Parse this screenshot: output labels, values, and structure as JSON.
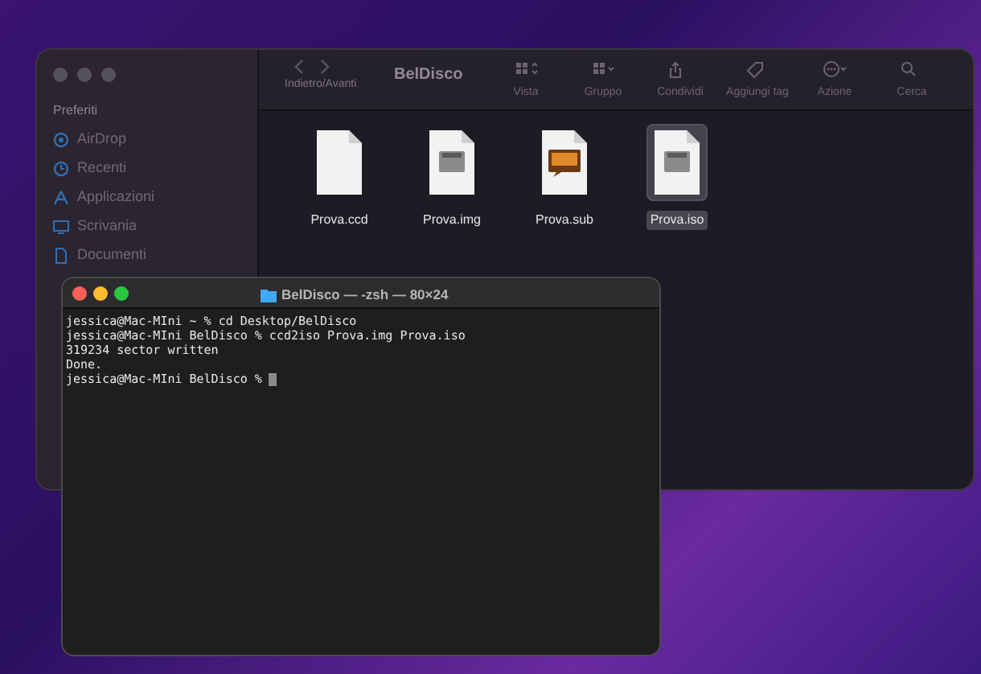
{
  "finder": {
    "title": "BelDisco",
    "nav_label": "Indietro/Avanti",
    "sidebar": {
      "section": "Preferiti",
      "items": [
        {
          "label": "AirDrop",
          "kind": "airdrop"
        },
        {
          "label": "Recenti",
          "kind": "clock"
        },
        {
          "label": "Applicazioni",
          "kind": "apps"
        },
        {
          "label": "Scrivania",
          "kind": "desktop"
        },
        {
          "label": "Documenti",
          "kind": "doc"
        }
      ]
    },
    "toolbar": [
      {
        "label": "Vista",
        "kind": "grid"
      },
      {
        "label": "Gruppo",
        "kind": "group"
      },
      {
        "label": "Condividi",
        "kind": "share"
      },
      {
        "label": "Aggiungi tag",
        "kind": "tag"
      },
      {
        "label": "Azione",
        "kind": "more"
      },
      {
        "label": "Cerca",
        "kind": "search"
      }
    ],
    "files": [
      {
        "name": "Prova.ccd",
        "kind": "blank",
        "selected": false
      },
      {
        "name": "Prova.img",
        "kind": "disk",
        "selected": false
      },
      {
        "name": "Prova.sub",
        "kind": "subtitle",
        "selected": false
      },
      {
        "name": "Prova.iso",
        "kind": "disk",
        "selected": true
      }
    ]
  },
  "terminal": {
    "title": "BelDisco — -zsh — 80×24",
    "lines": [
      "jessica@Mac-MIni ~ % cd Desktop/BelDisco",
      "jessica@Mac-MIni BelDisco % ccd2iso Prova.img Prova.iso",
      "319234 sector written",
      "Done.",
      "jessica@Mac-MIni BelDisco % "
    ]
  }
}
